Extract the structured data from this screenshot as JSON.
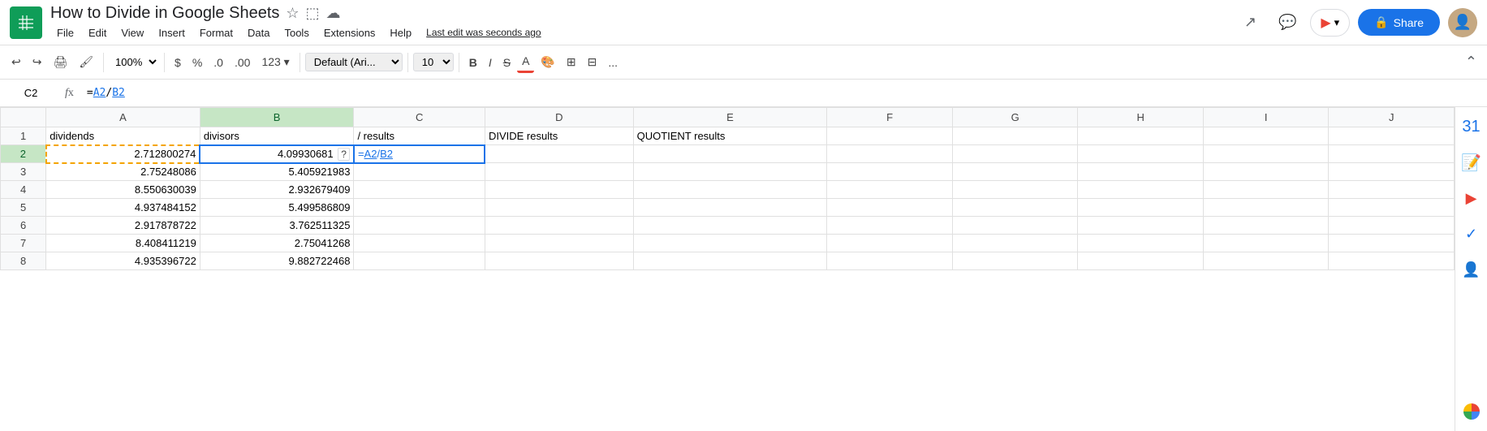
{
  "app": {
    "icon_color": "#0f9d58",
    "title": "How to Divide in Google Sheets",
    "last_edit": "Last edit was seconds ago"
  },
  "menu": {
    "items": [
      "File",
      "Edit",
      "View",
      "Insert",
      "Format",
      "Data",
      "Tools",
      "Extensions",
      "Help"
    ]
  },
  "toolbar": {
    "zoom": "100%",
    "currency": "$",
    "percent": "%",
    "decimal1": ".0",
    "decimal2": ".00",
    "more_formats": "123",
    "font_family": "Default (Ari...",
    "font_size": "10",
    "bold": "B",
    "italic": "I",
    "strikethrough": "S",
    "more_btn": "..."
  },
  "formula_bar": {
    "cell_ref": "C2",
    "formula": "=A2/B2",
    "formula_display": "=A2/B2"
  },
  "header_row": {
    "share_label": "Share",
    "meet_label": "Meet"
  },
  "columns": {
    "headers": [
      "",
      "A",
      "B",
      "C",
      "D",
      "E",
      "F",
      "G",
      "H",
      "I",
      "J"
    ]
  },
  "rows": [
    {
      "row": "1",
      "a": "dividends",
      "b": "divisors",
      "c": "/ results",
      "d": "DIVIDE results",
      "e": "QUOTIENT results",
      "f": "",
      "g": "",
      "h": "",
      "i": "",
      "j": ""
    },
    {
      "row": "2",
      "a": "2.712800274",
      "b": "4.09930681",
      "c": "=A2/B2",
      "d": "",
      "e": "",
      "f": "",
      "g": "",
      "h": "",
      "i": "",
      "j": ""
    },
    {
      "row": "3",
      "a": "2.75248086",
      "b": "5.405921983",
      "c": "",
      "d": "",
      "e": "",
      "f": "",
      "g": "",
      "h": "",
      "i": "",
      "j": ""
    },
    {
      "row": "4",
      "a": "8.550630039",
      "b": "2.932679409",
      "c": "",
      "d": "",
      "e": "",
      "f": "",
      "g": "",
      "h": "",
      "i": "",
      "j": ""
    },
    {
      "row": "5",
      "a": "4.937484152",
      "b": "5.499586809",
      "c": "",
      "d": "",
      "e": "",
      "f": "",
      "g": "",
      "h": "",
      "i": "",
      "j": ""
    },
    {
      "row": "6",
      "a": "2.917878722",
      "b": "3.762511325",
      "c": "",
      "d": "",
      "e": "",
      "f": "",
      "g": "",
      "h": "",
      "i": "",
      "j": ""
    },
    {
      "row": "7",
      "a": "8.408411219",
      "b": "2.75041268",
      "c": "",
      "d": "",
      "e": "",
      "f": "",
      "g": "",
      "h": "",
      "i": "",
      "j": ""
    },
    {
      "row": "8",
      "a": "4.935396722",
      "b": "9.882722468",
      "c": "",
      "d": "",
      "e": "",
      "f": "",
      "g": "",
      "h": "",
      "i": "",
      "j": ""
    }
  ],
  "sidebar": {
    "icons": [
      "calendar",
      "chat",
      "meet",
      "tasks",
      "contacts",
      "apps"
    ]
  }
}
